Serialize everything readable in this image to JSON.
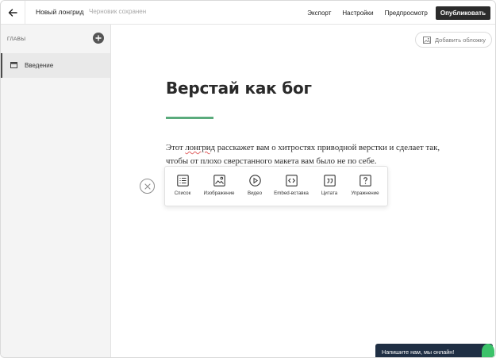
{
  "header": {
    "doc_title": "Новый лонгрид",
    "save_status": "Черновик сохранен",
    "actions": {
      "export": "Экспорт",
      "settings": "Настройки",
      "preview": "Предпросмотр",
      "publish": "Опубликовать"
    }
  },
  "sidebar": {
    "chapters_label": "ГЛАВЫ",
    "items": [
      {
        "label": "Введение"
      }
    ]
  },
  "main": {
    "add_cover_label": "Добавить обложку",
    "headline": "Верстай как бог",
    "body_before": "Этот ",
    "body_misspelled": "лонгрид",
    "body_after": " расскажет вам о хитростях приводной верстки и сделает так, чтобы от плохо сверстанного макета вам было не по себе.",
    "accent_color": "#5aab7c"
  },
  "insert_toolbar": {
    "tools": [
      {
        "label": "Список",
        "icon": "list-icon"
      },
      {
        "label": "Изображение",
        "icon": "image-icon"
      },
      {
        "label": "Видео",
        "icon": "play-icon"
      },
      {
        "label": "Embed-вставка",
        "icon": "code-icon"
      },
      {
        "label": "Цитата",
        "icon": "quote-icon"
      },
      {
        "label": "Упражнение",
        "icon": "question-icon"
      }
    ]
  },
  "chat": {
    "label": "Напишите нам, мы онлайн!",
    "color": "#1f2f44",
    "status_color": "#3cc26a"
  }
}
